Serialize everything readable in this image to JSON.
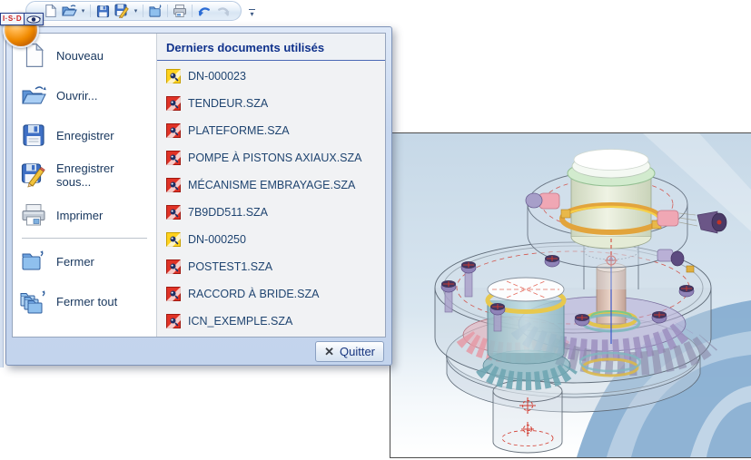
{
  "brand": {
    "logo_text": "I·S·D",
    "eye_icon": "eye-icon"
  },
  "toolbar": {
    "caret_glyph": "▾",
    "more_glyph": "▾",
    "buttons": [
      "new-document",
      "open",
      "save",
      "save-as",
      "close-document",
      "print",
      "undo",
      "redo"
    ]
  },
  "menu": {
    "left_items": [
      {
        "label": "Nouveau",
        "icon": "new-document-icon"
      },
      {
        "label": "Ouvrir...",
        "icon": "open-folder-icon"
      },
      {
        "label": "Enregistrer",
        "icon": "save-icon"
      },
      {
        "label": "Enregistrer sous...",
        "icon": "save-as-icon"
      },
      {
        "label": "Imprimer",
        "icon": "print-icon"
      },
      {
        "label": "Fermer",
        "icon": "close-document-icon"
      },
      {
        "label": "Fermer tout",
        "icon": "close-all-icon"
      }
    ],
    "recent": {
      "header": "Derniers documents utilisés",
      "items": [
        {
          "name": "DN-000023",
          "icon": "helios-doc-icon-yellow"
        },
        {
          "name": "TENDEUR.SZA",
          "icon": "sza-doc-icon-red"
        },
        {
          "name": "PLATEFORME.SZA",
          "icon": "sza-doc-icon-red"
        },
        {
          "name": "POMPE À PISTONS AXIAUX.SZA",
          "icon": "sza-doc-icon-red"
        },
        {
          "name": "MÉCANISME EMBRAYAGE.SZA",
          "icon": "sza-doc-icon-red"
        },
        {
          "name": "7B9DD511.SZA",
          "icon": "sza-doc-icon-red"
        },
        {
          "name": "DN-000250",
          "icon": "helios-doc-icon-yellow"
        },
        {
          "name": "POSTEST1.SZA",
          "icon": "sza-doc-icon-red"
        },
        {
          "name": "RACCORD À BRIDE.SZA",
          "icon": "sza-doc-icon-red"
        },
        {
          "name": "ICN_EXEMPLE.SZA",
          "icon": "sza-doc-icon-red"
        }
      ]
    },
    "footer": {
      "quit_label": "Quitter",
      "quit_icon_glyph": "✕"
    }
  },
  "colors": {
    "accent_navy": "#16357f",
    "menu_frame": "#c7d7ef",
    "doc_red": "#e03226",
    "doc_yellow": "#ffd21e",
    "orb_orange": "#f08a00",
    "viewport_bg": "#ccdce9",
    "swoosh_blue": "#86add0"
  }
}
